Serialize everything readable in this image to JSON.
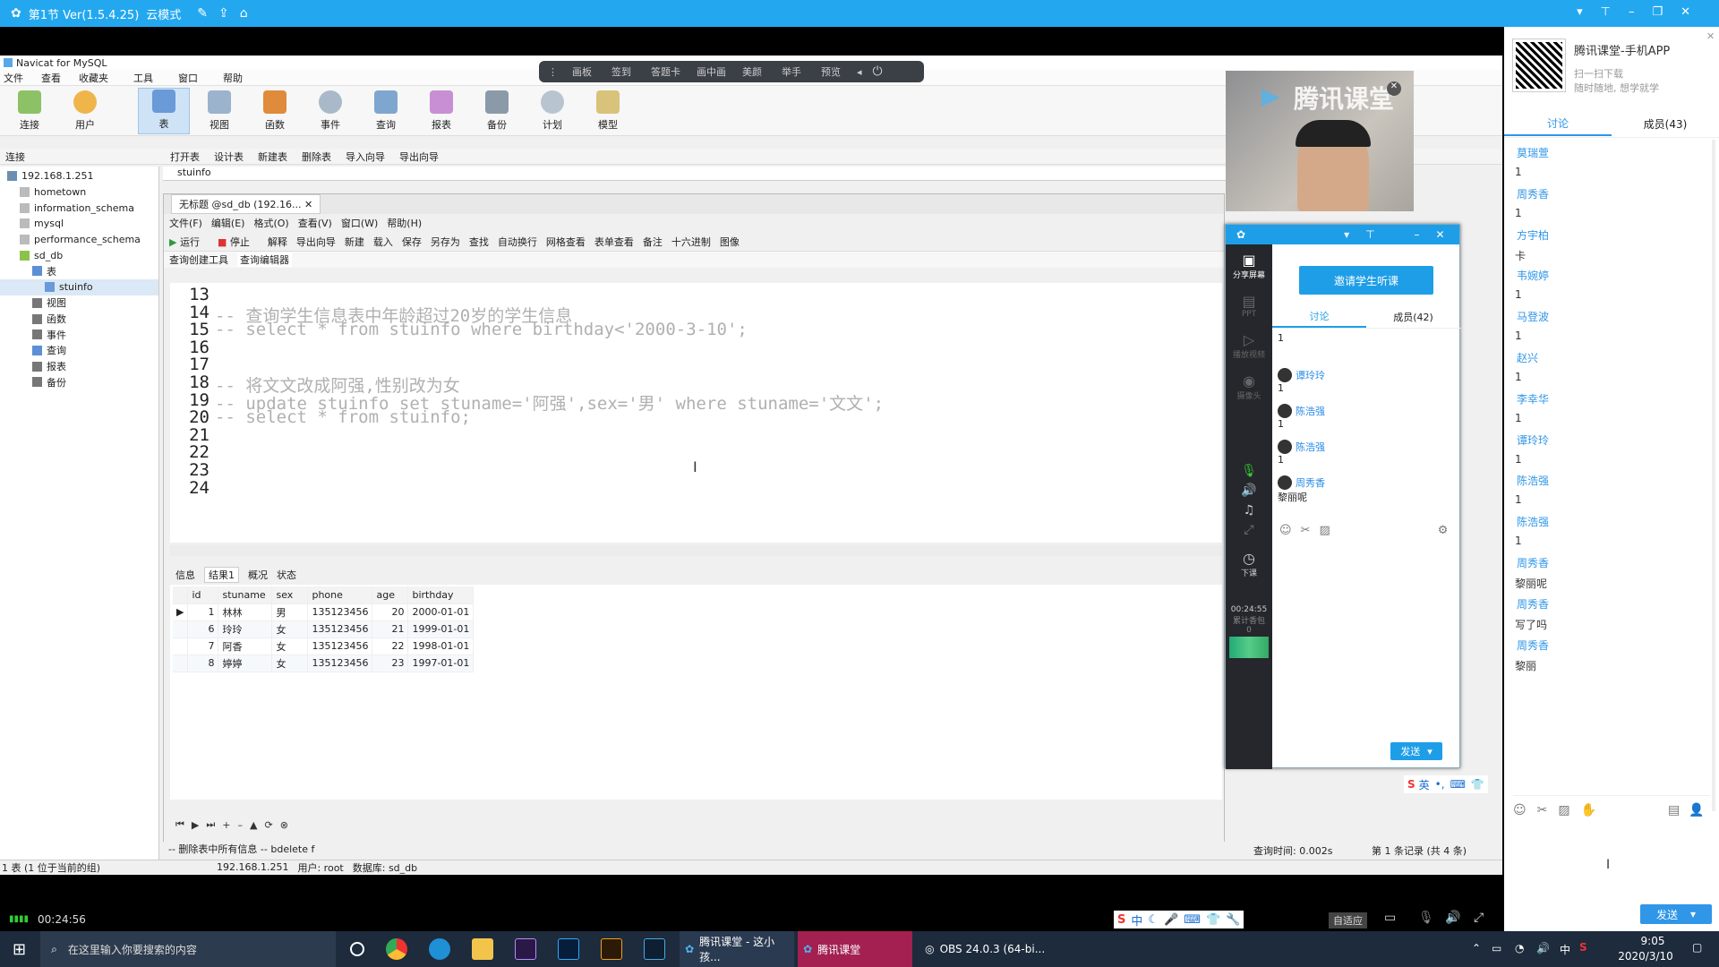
{
  "colors": {
    "accent": "#23a8f0",
    "link": "#2f96e8"
  },
  "topbar": {
    "title": "第1节 Ver(1.5.4.25)",
    "mode": "云模式"
  },
  "overlay_toolbar": [
    "画板",
    "签到",
    "答题卡",
    "画中画",
    "美颜",
    "举手",
    "预览"
  ],
  "navicat": {
    "title": "Navicat for MySQL",
    "menu": [
      "文件",
      "查看",
      "收藏夹",
      "工具",
      "窗口",
      "帮助"
    ],
    "toolbar": [
      "连接",
      "用户",
      "表",
      "视图",
      "函数",
      "事件",
      "查询",
      "报表",
      "备份",
      "计划",
      "模型"
    ],
    "objtoolbar": [
      "打开表",
      "设计表",
      "新建表",
      "删除表",
      "导入向导",
      "导出向导"
    ],
    "conn_header": "连接",
    "object_tab": "stuinfo",
    "tree": [
      {
        "label": "192.168.1.251",
        "indent": 0,
        "icon": "server-icon",
        "color": "#6a8fb0"
      },
      {
        "label": "hometown",
        "indent": 1,
        "icon": "database-icon",
        "color": "#bbb"
      },
      {
        "label": "information_schema",
        "indent": 1,
        "icon": "database-icon",
        "color": "#bbb"
      },
      {
        "label": "mysql",
        "indent": 1,
        "icon": "database-icon",
        "color": "#bbb"
      },
      {
        "label": "performance_schema",
        "indent": 1,
        "icon": "database-icon",
        "color": "#bbb"
      },
      {
        "label": "sd_db",
        "indent": 1,
        "icon": "database-icon",
        "color": "#8bc34a"
      },
      {
        "label": "表",
        "indent": 2,
        "icon": "table-folder-icon",
        "color": "#5b8fd6"
      },
      {
        "label": "stuinfo",
        "indent": 3,
        "icon": "table-icon",
        "color": "#6a9ad8",
        "selected": true
      },
      {
        "label": "视图",
        "indent": 2,
        "icon": "view-icon",
        "color": "#777"
      },
      {
        "label": "函数",
        "indent": 2,
        "icon": "function-icon",
        "color": "#777"
      },
      {
        "label": "事件",
        "indent": 2,
        "icon": "event-icon",
        "color": "#777"
      },
      {
        "label": "查询",
        "indent": 2,
        "icon": "query-icon",
        "color": "#5b8fd6"
      },
      {
        "label": "报表",
        "indent": 2,
        "icon": "report-icon",
        "color": "#777"
      },
      {
        "label": "备份",
        "indent": 2,
        "icon": "backup-icon",
        "color": "#777"
      }
    ],
    "query_tab": "无标题 @sd_db (192.16...",
    "query_menu": [
      "文件(F)",
      "编辑(E)",
      "格式(O)",
      "查看(V)",
      "窗口(W)",
      "帮助(H)"
    ],
    "query_toolbar": [
      "运行",
      "停止",
      "解释",
      "导出向导",
      "新建",
      "载入",
      "保存",
      "另存为",
      "查找",
      "自动换行",
      "网格查看",
      "表单查看",
      "备注",
      "十六进制",
      "图像"
    ],
    "editor_tabs": [
      "查询创建工具",
      "查询编辑器"
    ],
    "code": [
      {
        "n": "13",
        "t": ""
      },
      {
        "n": "14",
        "t": "-- 查询学生信息表中年龄超过20岁的学生信息"
      },
      {
        "n": "15",
        "t": "-- select * from stuinfo where birthday<'2000-3-10';"
      },
      {
        "n": "16",
        "t": ""
      },
      {
        "n": "17",
        "t": ""
      },
      {
        "n": "18",
        "t": "-- 将文文改成阿强,性别改为女"
      },
      {
        "n": "19",
        "t": "-- update stuinfo set stuname='阿强',sex='男' where stuname='文文';"
      },
      {
        "n": "20",
        "t": "-- select * from stuinfo;"
      },
      {
        "n": "21",
        "t": ""
      },
      {
        "n": "22",
        "t": ""
      },
      {
        "n": "23",
        "t": ""
      },
      {
        "n": "24",
        "t": ""
      }
    ],
    "result_tabs": [
      "信息",
      "结果1",
      "概况",
      "状态"
    ],
    "result_cols": [
      "id",
      "stuname",
      "sex",
      "phone",
      "age",
      "birthday"
    ],
    "result_rows": [
      [
        "1",
        "林林",
        "男",
        "135123456",
        "20",
        "2000-01-01"
      ],
      [
        "6",
        "玲玲",
        "女",
        "135123456",
        "21",
        "1999-01-01"
      ],
      [
        "7",
        "阿香",
        "女",
        "135123456",
        "22",
        "1998-01-01"
      ],
      [
        "8",
        "婷婷",
        "女",
        "135123456",
        "23",
        "1997-01-01"
      ]
    ],
    "bottom_sql": "-- 删除表中所有信息 -- bdelete f",
    "query_time": "查询时间: 0.002s",
    "record_info": "第 1 条记录 (共 4 条)",
    "status_left": "1 表 (1 位于当前的组)",
    "status_host": "192.168.1.251",
    "status_user": "用户: root",
    "status_db": "数据库: sd_db"
  },
  "tencent_panel": {
    "left_items": [
      "分享屏幕",
      "PPT",
      "播放视频",
      "摄像头"
    ],
    "end_label": "下课",
    "timer": "00:24:55",
    "gift_label": "累计香包",
    "gift_count": "0",
    "invite": "邀请学生听课",
    "tabs": [
      "讨论",
      "成员(42)"
    ],
    "messages": [
      {
        "name": "",
        "text": "1"
      },
      {
        "name": "谭玲玲",
        "text": "1"
      },
      {
        "name": "陈浩强",
        "text": "1"
      },
      {
        "name": "陈浩强",
        "text": "1"
      },
      {
        "name": "周秀香",
        "text": "黎丽呢"
      },
      {
        "name": "周秀香",
        "text": "写了吗"
      },
      {
        "name": "周秀香",
        "text": "黎丽"
      }
    ],
    "send": "发送"
  },
  "video": {
    "brand": "腾讯课堂"
  },
  "sidebar": {
    "app_title": "腾讯课堂-手机APP",
    "app_sub1": "扫一扫下载",
    "app_sub2": "随时随地, 想学就学",
    "tabs": [
      "讨论",
      "成员(43)"
    ],
    "messages": [
      {
        "name": "莫瑞萱",
        "text": "1"
      },
      {
        "name": "周秀香",
        "text": "1"
      },
      {
        "name": "方宇柏",
        "text": "卡"
      },
      {
        "name": "韦婉婷",
        "text": "1"
      },
      {
        "name": "马登波",
        "text": "1"
      },
      {
        "name": "赵兴",
        "text": "1"
      },
      {
        "name": "李幸华",
        "text": "1"
      },
      {
        "name": "谭玲玲",
        "text": "1"
      },
      {
        "name": "陈浩强",
        "text": "1"
      },
      {
        "name": "陈浩强",
        "text": "1"
      },
      {
        "name": "周秀香",
        "text": "黎丽呢"
      },
      {
        "name": "周秀香",
        "text": "写了吗"
      },
      {
        "name": "周秀香",
        "text": "黎丽"
      }
    ],
    "send": "发送"
  },
  "obs_status": {
    "timer": "00:24:56",
    "adapt": "自适应"
  },
  "taskbar": {
    "search": "在这里输入你要搜索的内容",
    "apps": [
      {
        "label": "腾讯课堂 - 这小孩...",
        "icon": "tencent-class-icon"
      },
      {
        "label": "腾讯课堂",
        "icon": "tencent-class-icon"
      },
      {
        "label": "OBS 24.0.3 (64-bi...",
        "icon": "obs-icon"
      }
    ],
    "ime": "中",
    "time": "9:05",
    "date": "2020/3/10"
  }
}
